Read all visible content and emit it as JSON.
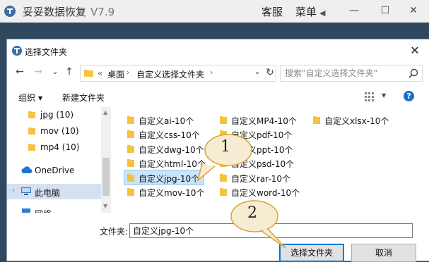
{
  "app": {
    "title": "妥妥数据恢复",
    "version": "V7.9",
    "service_label": "客服",
    "menu_label": "菜单",
    "menu_arrow": "◀",
    "minimize_glyph": "—",
    "maximize_glyph": "☐",
    "close_glyph": "✕"
  },
  "dialog": {
    "title": "选择文件夹",
    "close_glyph": "✕",
    "nav": {
      "back": "←",
      "forward": "→",
      "recent": "⌄",
      "up": "↑",
      "refresh": "↻"
    },
    "address": {
      "overflow": "«",
      "segments": [
        "桌面",
        "自定义选择文件夹"
      ],
      "separator": "›",
      "dropdown": "⌄"
    },
    "search": {
      "placeholder": "搜索\"自定义选择文件夹\""
    },
    "toolbar": {
      "organize": "组织",
      "organize_arrow": "▼",
      "new_folder": "新建文件夹",
      "view_arrow": "▼",
      "help": "?"
    },
    "tree": [
      {
        "label": "jpg (10)",
        "icon": "folder-icon"
      },
      {
        "label": "mov (10)",
        "icon": "folder-icon"
      },
      {
        "label": "mp4 (10)",
        "icon": "folder-icon"
      },
      {
        "label": "OneDrive",
        "icon": "cloud-icon"
      },
      {
        "label": "此电脑",
        "icon": "computer-icon",
        "selected": true
      },
      {
        "label": "网络",
        "icon": "network-icon"
      }
    ],
    "files": {
      "col1": [
        "自定义ai-10个",
        "自定义css-10个",
        "自定义dwg-10个",
        "自定义html-10个",
        "自定义jpg-10个",
        "自定义mov-10个"
      ],
      "col2": [
        "自定义MP4-10个",
        "自定义pdf-10个",
        "自定义ppt-10个",
        "自定义psd-10个",
        "自定义rar-10个",
        "自定义word-10个"
      ],
      "col3": [
        "自定义xlsx-10个"
      ],
      "selected": "自定义jpg-10个"
    },
    "folder_field": {
      "label": "文件夹:",
      "value": "自定义jpg-10个"
    },
    "select_button": "选择文件夹",
    "cancel_button": "取消"
  },
  "annotations": {
    "callout_1": "1",
    "callout_2": "2"
  },
  "colors": {
    "accent": "#0078d7",
    "folder": "#f5c342",
    "callout_fill": "#f6ecd2",
    "callout_stroke": "#d9a23a"
  }
}
